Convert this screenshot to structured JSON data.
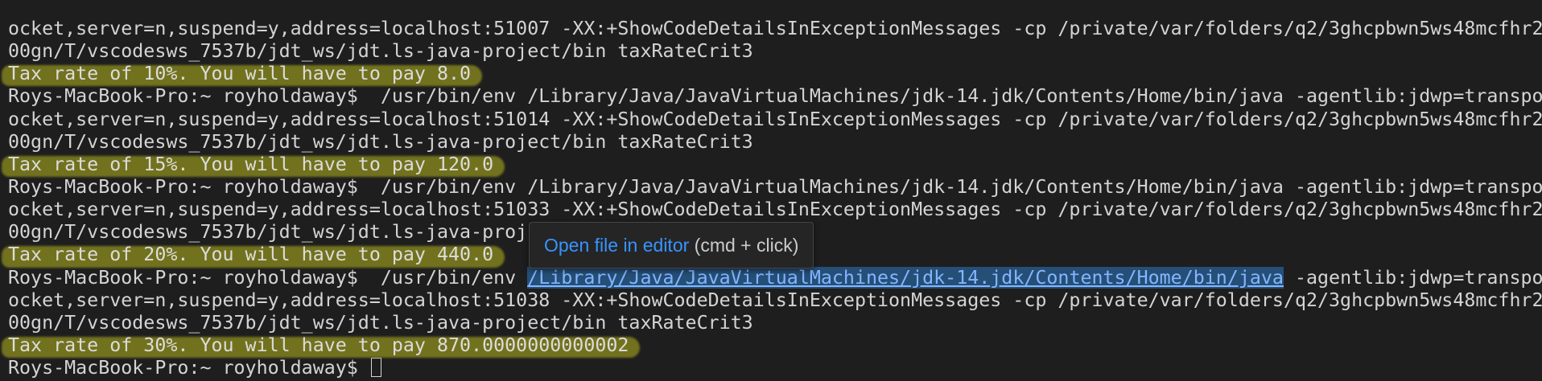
{
  "terminal": {
    "lines": [
      "ocket,server=n,suspend=y,address=localhost:51007 -XX:+ShowCodeDetailsInExceptionMessages -cp /private/var/folders/q2/3ghcpbwn5ws48mcfhr2",
      "00gn/T/vscodesws_7537b/jdt_ws/jdt.ls-java-project/bin taxRateCrit3",
      "Tax rate of 10%. You will have to pay 8.0",
      "Roys-MacBook-Pro:~ royholdaway$  /usr/bin/env /Library/Java/JavaVirtualMachines/jdk-14.jdk/Contents/Home/bin/java -agentlib:jdwp=transpo",
      "ocket,server=n,suspend=y,address=localhost:51014 -XX:+ShowCodeDetailsInExceptionMessages -cp /private/var/folders/q2/3ghcpbwn5ws48mcfhr2",
      "00gn/T/vscodesws_7537b/jdt_ws/jdt.ls-java-project/bin taxRateCrit3",
      "Tax rate of 15%. You will have to pay 120.0",
      "Roys-MacBook-Pro:~ royholdaway$  /usr/bin/env /Library/Java/JavaVirtualMachines/jdk-14.jdk/Contents/Home/bin/java -agentlib:jdwp=transpo",
      "ocket,server=n,suspend=y,address=localhost:51033 -XX:+ShowCodeDetailsInExceptionMessages -cp /private/var/folders/q2/3ghcpbwn5ws48mcfhr2",
      "00gn/T/vscodesws_7537b/jdt_ws/jdt.ls-java-proj",
      "Tax rate of 20%. You will have to pay 440.0",
      "ocket,server=n,suspend=y,address=localhost:51038 -XX:+ShowCodeDetailsInExceptionMessages -cp /private/var/folders/q2/3ghcpbwn5ws48mcfhr2",
      "00gn/T/vscodesws_7537b/jdt_ws/jdt.ls-java-project/bin taxRateCrit3",
      "Tax rate of 30%. You will have to pay 870.0000000000002"
    ],
    "link_line": {
      "prefix": "Roys-MacBook-Pro:~ royholdaway$  /usr/bin/env ",
      "link": "/Library/Java/JavaVirtualMachines/jdk-14.jdk/Contents/Home/bin/java",
      "suffix": " -agentlib:jdwp=transpo"
    },
    "prompt": "Roys-MacBook-Pro:~ royholdaway$ "
  },
  "tooltip": {
    "action": "Open file in editor",
    "hint": " (cmd + click)"
  },
  "colors": {
    "background": "#1e1e1e",
    "text": "#d4d4d4",
    "highlight": "#8a8a1e",
    "link": "#82b6ff",
    "tooltip_action": "#3794ff"
  }
}
